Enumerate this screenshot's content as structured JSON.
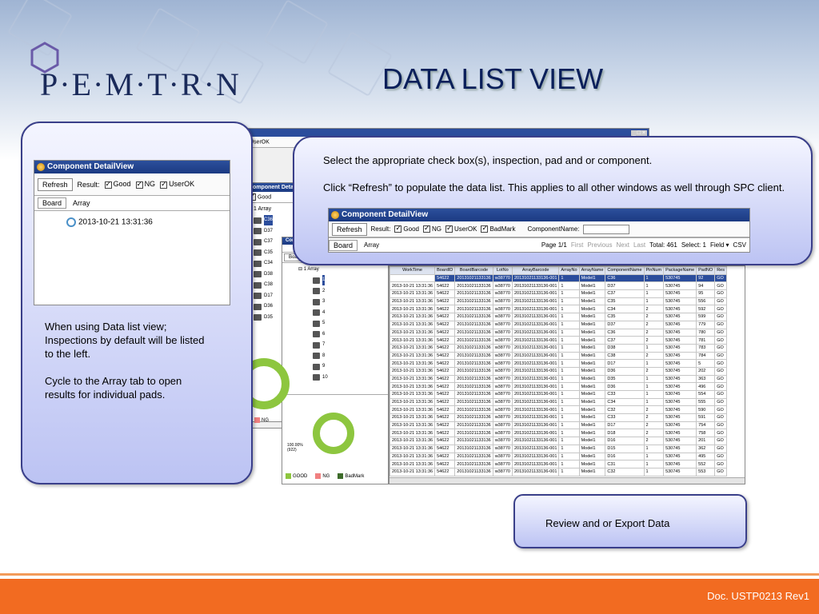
{
  "slide": {
    "title": "DATA LIST VIEW",
    "logo": "P·E·M·T·R·N",
    "footer": "Doc. USTP0213 Rev1"
  },
  "left_callout": {
    "text1": "When using Data list view; Inspections by default will be listed to the left.",
    "text2": "Cycle to the Array tab to open results for individual pads."
  },
  "right_callout": {
    "text1": "Select the appropriate check box(s), inspection, pad and or component.",
    "text2": "Click “Refresh” to populate the data list. This applies to all other windows as well through SPC client."
  },
  "bottom_callout": {
    "text": "Review and or Export Data"
  },
  "window": {
    "title": "Component DetailView",
    "refresh": "Refresh",
    "result_label": "Result:",
    "good": "Good",
    "ng": "NG",
    "userok": "UserOK",
    "badmark": "BadMark",
    "component_label": "ComponentName:",
    "tab_board": "Board",
    "tab_array": "Array",
    "left_timestamp": "2013-10-21 13:31:36",
    "pager": {
      "page": "Page 1/1",
      "first": "First",
      "previous": "Previous",
      "next": "Next",
      "last": "Last",
      "total": "Total: 461",
      "select": "Select: 1",
      "field": "Field",
      "csv": "CSV"
    }
  },
  "tree": {
    "root": "1 Array",
    "items": [
      "1",
      "2",
      "3",
      "4",
      "5",
      "6",
      "7",
      "8",
      "9",
      "10"
    ],
    "components": [
      "C36",
      "D37",
      "C37",
      "C35",
      "C34",
      "D38",
      "C38",
      "D17",
      "D36",
      "D35"
    ]
  },
  "chart": {
    "percent": "100.00%",
    "count": "(922)",
    "legend_good": "GOOD",
    "legend_ng": "NG",
    "legend_badmark": "BadMark",
    "colors": {
      "good": "#8dc63f",
      "ng": "#f08080",
      "badmark": "#3d6b2a"
    }
  },
  "table": {
    "headers": [
      "WorkTime",
      "BoardID",
      "BoardBarcode",
      "LotNo",
      "ArrayBarcode",
      "ArrayNo",
      "ArrayName",
      "ComponentName",
      "PinNum",
      "PackageName",
      "PadNO",
      "Res"
    ],
    "rows": [
      [
        "2013-10-21 13:31:36",
        "54622",
        "20131021133136",
        "w38770",
        "20131021133136-001",
        "1",
        "Model1",
        "C36",
        "1",
        "530745",
        "92",
        "GO"
      ],
      [
        "2013-10-21 13:31:36",
        "54622",
        "20131021133136",
        "w38770",
        "20131021133136-001",
        "1",
        "Model1",
        "D37",
        "1",
        "530745",
        "94",
        "GO"
      ],
      [
        "2013-10-21 13:31:36",
        "54622",
        "20131021133136",
        "w38770",
        "20131021133136-001",
        "1",
        "Model1",
        "C37",
        "1",
        "530745",
        "95",
        "GO"
      ],
      [
        "2013-10-21 13:31:36",
        "54622",
        "20131021133136",
        "w38770",
        "20131021133136-001",
        "1",
        "Model1",
        "C35",
        "1",
        "530745",
        "556",
        "GO"
      ],
      [
        "2013-10-21 13:31:36",
        "54622",
        "20131021133136",
        "w38770",
        "20131021133136-001",
        "1",
        "Model1",
        "C34",
        "2",
        "530745",
        "592",
        "GO"
      ],
      [
        "2013-10-21 13:31:36",
        "54622",
        "20131021133136",
        "w38770",
        "20131021133136-001",
        "1",
        "Model1",
        "C35",
        "2",
        "530745",
        "599",
        "GO"
      ],
      [
        "2013-10-21 13:31:36",
        "54622",
        "20131021133136",
        "w38770",
        "20131021133136-001",
        "1",
        "Model1",
        "D37",
        "2",
        "530745",
        "779",
        "GO"
      ],
      [
        "2013-10-21 13:31:36",
        "54622",
        "20131021133136",
        "w38770",
        "20131021133136-001",
        "1",
        "Model1",
        "C36",
        "2",
        "530745",
        "780",
        "GO"
      ],
      [
        "2013-10-21 13:31:36",
        "54622",
        "20131021133136",
        "w38770",
        "20131021133136-001",
        "1",
        "Model1",
        "C37",
        "2",
        "530745",
        "781",
        "GO"
      ],
      [
        "2013-10-21 13:31:36",
        "54622",
        "20131021133136",
        "w38770",
        "20131021133136-001",
        "1",
        "Model1",
        "D38",
        "1",
        "530745",
        "783",
        "GO"
      ],
      [
        "2013-10-21 13:31:36",
        "54622",
        "20131021133136",
        "w38770",
        "20131021133136-001",
        "1",
        "Model1",
        "C38",
        "2",
        "530745",
        "784",
        "GO"
      ],
      [
        "2013-10-21 13:31:36",
        "54622",
        "20131021133136",
        "w38770",
        "20131021133136-001",
        "1",
        "Model1",
        "D17",
        "1",
        "530745",
        "5",
        "GO"
      ],
      [
        "2013-10-21 13:31:36",
        "54622",
        "20131021133136",
        "w38770",
        "20131021133136-001",
        "1",
        "Model1",
        "D36",
        "2",
        "530745",
        "202",
        "GO"
      ],
      [
        "2013-10-21 13:31:36",
        "54622",
        "20131021133136",
        "w38770",
        "20131021133136-001",
        "1",
        "Model1",
        "D35",
        "1",
        "530745",
        "363",
        "GO"
      ],
      [
        "2013-10-21 13:31:36",
        "54622",
        "20131021133136",
        "w38770",
        "20131021133136-001",
        "1",
        "Model1",
        "D36",
        "1",
        "530745",
        "496",
        "GO"
      ],
      [
        "2013-10-21 13:31:36",
        "54622",
        "20131021133136",
        "w38770",
        "20131021133136-001",
        "1",
        "Model1",
        "C33",
        "1",
        "530745",
        "554",
        "GO"
      ],
      [
        "2013-10-21 13:31:36",
        "54622",
        "20131021133136",
        "w38770",
        "20131021133136-001",
        "1",
        "Model1",
        "C34",
        "1",
        "530745",
        "555",
        "GO"
      ],
      [
        "2013-10-21 13:31:36",
        "54622",
        "20131021133136",
        "w38770",
        "20131021133136-001",
        "1",
        "Model1",
        "C32",
        "2",
        "530745",
        "590",
        "GO"
      ],
      [
        "2013-10-21 13:31:36",
        "54622",
        "20131021133136",
        "w38770",
        "20131021133136-001",
        "1",
        "Model1",
        "C33",
        "2",
        "530745",
        "591",
        "GO"
      ],
      [
        "2013-10-21 13:31:36",
        "54622",
        "20131021133136",
        "w38770",
        "20131021133136-001",
        "1",
        "Model1",
        "D17",
        "2",
        "530745",
        "754",
        "GO"
      ],
      [
        "2013-10-21 13:31:36",
        "54622",
        "20131021133136",
        "w38770",
        "20131021133136-001",
        "1",
        "Model1",
        "D18",
        "2",
        "530745",
        "758",
        "GO"
      ],
      [
        "2013-10-21 13:31:36",
        "54622",
        "20131021133136",
        "w38770",
        "20131021133136-001",
        "1",
        "Model1",
        "D16",
        "2",
        "530745",
        "201",
        "GO"
      ],
      [
        "2013-10-21 13:31:36",
        "54622",
        "20131021133136",
        "w38770",
        "20131021133136-001",
        "1",
        "Model1",
        "D15",
        "1",
        "530745",
        "362",
        "GO"
      ],
      [
        "2013-10-21 13:31:36",
        "54622",
        "20131021133136",
        "w38770",
        "20131021133136-001",
        "1",
        "Model1",
        "D16",
        "1",
        "530745",
        "495",
        "GO"
      ],
      [
        "2013-10-21 13:31:36",
        "54622",
        "20131021133136",
        "w38770",
        "20131021133136-001",
        "1",
        "Model1",
        "C31",
        "1",
        "530745",
        "552",
        "GO"
      ],
      [
        "2013-10-21 13:31:36",
        "54622",
        "20131021133136",
        "w38770",
        "20131021133136-001",
        "1",
        "Model1",
        "C32",
        "1",
        "530745",
        "553",
        "GO"
      ]
    ]
  }
}
